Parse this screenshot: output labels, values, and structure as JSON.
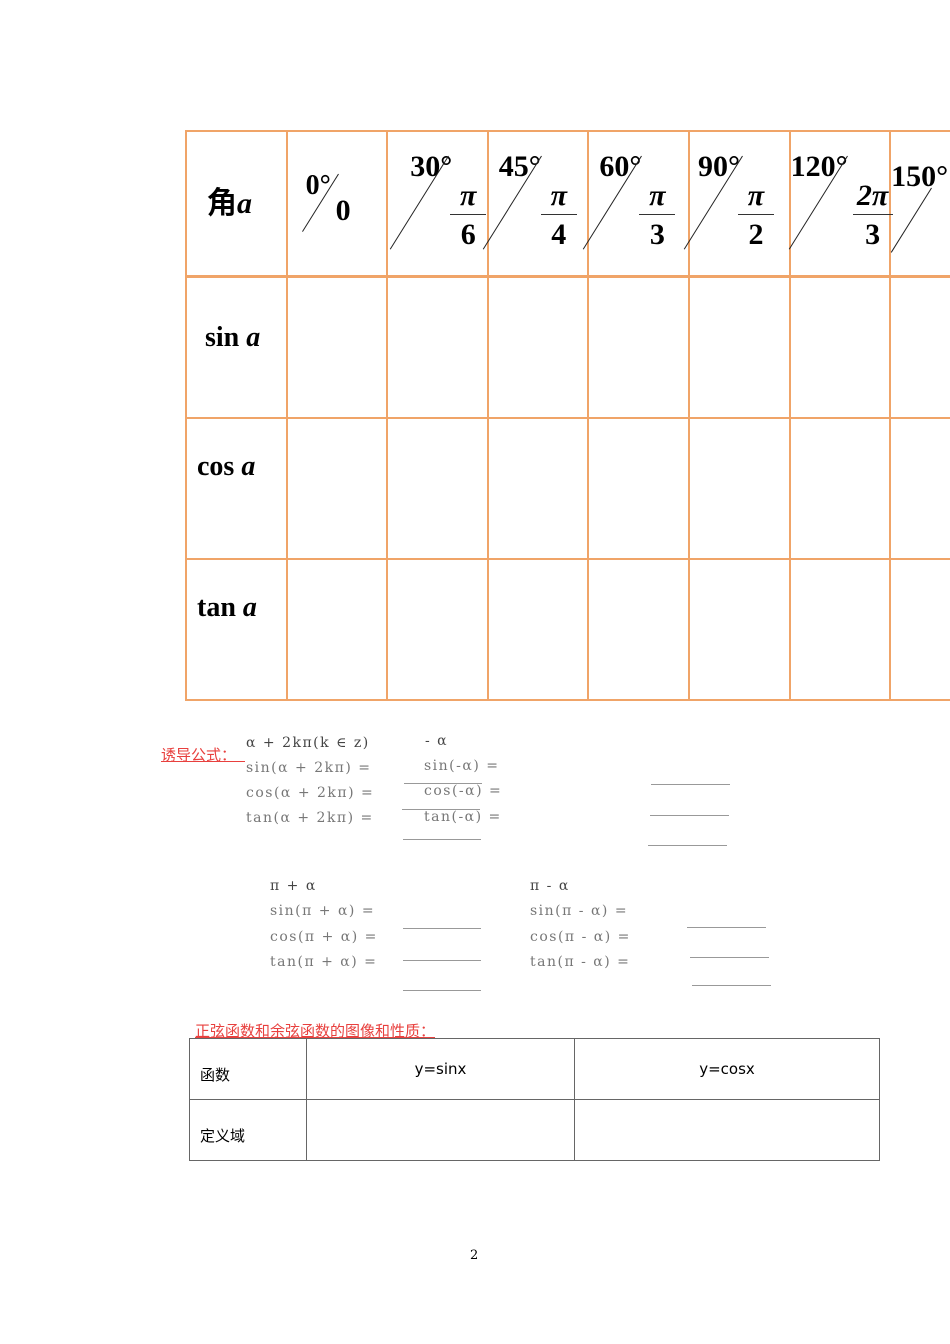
{
  "trig_table": {
    "header_label": {
      "text": "角",
      "var": "a"
    },
    "angles": [
      {
        "deg": "0°",
        "rad_num": "",
        "rad_den": "0"
      },
      {
        "deg": "30°",
        "rad_num": "π",
        "rad_den": "6"
      },
      {
        "deg": "45°",
        "rad_num": "π",
        "rad_den": "4"
      },
      {
        "deg": "60°",
        "rad_num": "π",
        "rad_den": "3"
      },
      {
        "deg": "90°",
        "rad_num": "π",
        "rad_den": "2"
      },
      {
        "deg": "120°",
        "rad_num": "2π",
        "rad_den": "3"
      },
      {
        "deg": "150°",
        "rad_num": "",
        "rad_den": ""
      }
    ],
    "rows": [
      {
        "func": "sin",
        "var": "a"
      },
      {
        "func": "cos",
        "var": "a"
      },
      {
        "func": "tan",
        "var": "a"
      }
    ]
  },
  "induction": {
    "title": "诱导公式：",
    "group1": {
      "header": "α + 2kπ(k ∈ z)",
      "lines": [
        "sin(α + 2kπ) =",
        "cos(α + 2kπ) =",
        "tan(α + 2kπ) ="
      ]
    },
    "group2": {
      "header": "- α",
      "lines": [
        "sin(-α) =",
        "cos(-α) =",
        "tan(-α) ="
      ]
    },
    "group3": {
      "header": "π + α",
      "lines": [
        "sin(π + α) =",
        "cos(π + α) =",
        "tan(π + α) ="
      ]
    },
    "group4": {
      "header": "π - α",
      "lines": [
        "sin(π - α) =",
        "cos(π - α) =",
        "tan(π - α) ="
      ]
    }
  },
  "properties": {
    "title": "正弦函数和余弦函数的图像和性质：",
    "header": [
      "函数",
      "y=sinx",
      "y=cosx"
    ],
    "rows": [
      [
        "定义域",
        "",
        ""
      ]
    ]
  },
  "page_number": "2"
}
